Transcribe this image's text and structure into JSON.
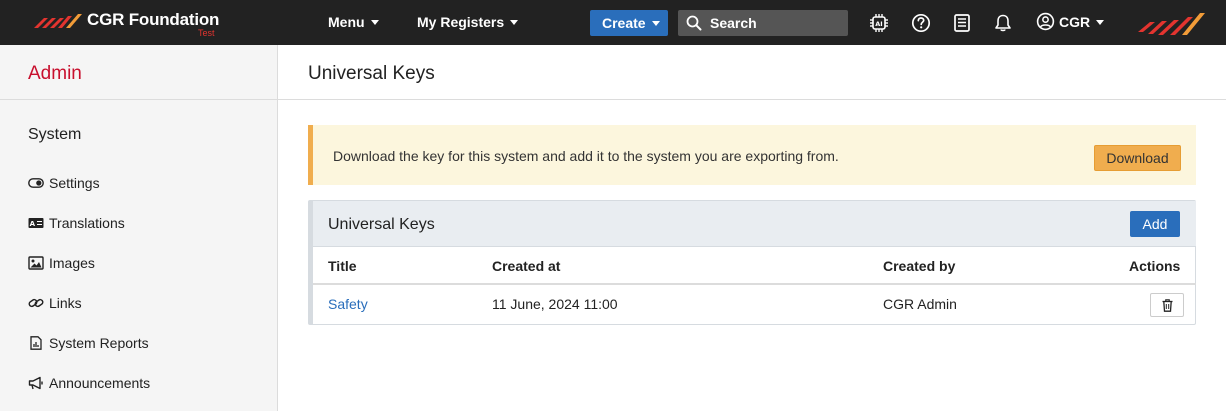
{
  "topbar": {
    "brand_name": "CGR Foundation",
    "brand_env": "Test",
    "menu_label": "Menu",
    "registers_label": "My Registers",
    "create_label": "Create",
    "search_placeholder": "Search",
    "user_label": "CGR",
    "icons": [
      "ai-chip-icon",
      "help-icon",
      "book-icon",
      "bell-icon",
      "user-circle-icon"
    ]
  },
  "sidebar": {
    "title": "Admin",
    "section_title": "System",
    "items": [
      {
        "label": "Settings",
        "icon": "toggle-icon"
      },
      {
        "label": "Translations",
        "icon": "translate-icon"
      },
      {
        "label": "Images",
        "icon": "image-icon"
      },
      {
        "label": "Links",
        "icon": "link-icon"
      },
      {
        "label": "System Reports",
        "icon": "report-icon"
      },
      {
        "label": "Announcements",
        "icon": "megaphone-icon"
      }
    ]
  },
  "main": {
    "page_title": "Universal Keys",
    "alert": {
      "text": "Download the key for this system and add it to the system you are exporting from.",
      "download_label": "Download"
    },
    "panel": {
      "title": "Universal Keys",
      "add_label": "Add",
      "columns": [
        "Title",
        "Created at",
        "Created by",
        "Actions"
      ],
      "rows": [
        {
          "title": "Safety",
          "created_at": "11 June, 2024 11:00",
          "created_by": "CGR Admin"
        }
      ]
    }
  },
  "colors": {
    "topbar_bg": "#222222",
    "brand_red": "#c8102e",
    "primary_blue": "#2a6ebb",
    "warning_orange": "#f0ad4e",
    "alert_bg": "#fcf6dd"
  }
}
